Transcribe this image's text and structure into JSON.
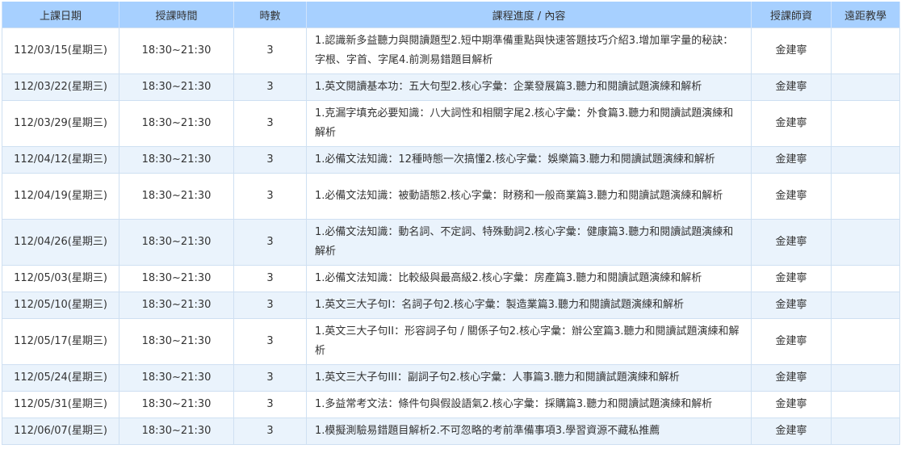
{
  "headers": {
    "date": "上課日期",
    "time": "授課時間",
    "hours": "時數",
    "content": "課程進度 / 內容",
    "teacher": "授課師資",
    "remote": "遠距教學"
  },
  "rows": [
    {
      "date": "112/03/15(星期三)",
      "time": "18:30~21:30",
      "hours": "3",
      "content": "1.認識新多益聽力與閱讀題型2.短中期準備重點與快速答題技巧介紹3.增加單字量的秘訣：字根、字首、字尾4.前測易錯題目解析",
      "teacher": "金建寧",
      "remote": ""
    },
    {
      "date": "112/03/22(星期三)",
      "time": "18:30~21:30",
      "hours": "3",
      "content": "1.英文閱讀基本功：五大句型2.核心字彙：企業發展篇3.聽力和閱讀試題演練和解析",
      "teacher": "金建寧",
      "remote": ""
    },
    {
      "date": "112/03/29(星期三)",
      "time": "18:30~21:30",
      "hours": "3",
      "content": "1.克漏字填充必要知識：八大詞性和相關字尾2.核心字彙：外食篇3.聽力和閱讀試題演練和解析",
      "teacher": "金建寧",
      "remote": ""
    },
    {
      "date": "112/04/12(星期三)",
      "time": "18:30~21:30",
      "hours": "3",
      "content": "1.必備文法知識：12種時態一次搞懂2.核心字彙：娛樂篇3.聽力和閱讀試題演練和解析",
      "teacher": "金建寧",
      "remote": ""
    },
    {
      "date": "112/04/19(星期三)",
      "time": "18:30~21:30",
      "hours": "3",
      "content": "1.必備文法知識：被動語態2.核心字彙：財務和一般商業篇3.聽力和閱讀試題演練和解析",
      "teacher": "金建寧",
      "remote": ""
    },
    {
      "date": "112/04/26(星期三)",
      "time": "18:30~21:30",
      "hours": "3",
      "content": "1.必備文法知識：動名詞、不定詞、特殊動詞2.核心字彙：健康篇3.聽力和閱讀試題演練和解析",
      "teacher": "金建寧",
      "remote": ""
    },
    {
      "date": "112/05/03(星期三)",
      "time": "18:30~21:30",
      "hours": "3",
      "content": "1.必備文法知識：比較級與最高級2.核心字彙：房產篇3.聽力和閱讀試題演練和解析",
      "teacher": "金建寧",
      "remote": ""
    },
    {
      "date": "112/05/10(星期三)",
      "time": "18:30~21:30",
      "hours": "3",
      "content": "1.英文三大子句I：名詞子句2.核心字彙：製造業篇3.聽力和閱讀試題演練和解析",
      "teacher": "金建寧",
      "remote": ""
    },
    {
      "date": "112/05/17(星期三)",
      "time": "18:30~21:30",
      "hours": "3",
      "content": "1.英文三大子句II：形容詞子句 / 關係子句2.核心字彙：辦公室篇3.聽力和閱讀試題演練和解析",
      "teacher": "金建寧",
      "remote": ""
    },
    {
      "date": "112/05/24(星期三)",
      "time": "18:30~21:30",
      "hours": "3",
      "content": "1.英文三大子句III：副詞子句2.核心字彙：人事篇3.聽力和閱讀試題演練和解析",
      "teacher": "金建寧",
      "remote": ""
    },
    {
      "date": "112/05/31(星期三)",
      "time": "18:30~21:30",
      "hours": "3",
      "content": "1.多益常考文法：條件句與假設語氣2.核心字彙：採購篇3.聽力和閱讀試題演練和解析",
      "teacher": "金建寧",
      "remote": ""
    },
    {
      "date": "112/06/07(星期三)",
      "time": "18:30~21:30",
      "hours": "3",
      "content": "1.模擬測驗易錯題目解析2.不可忽略的考前準備事項3.學習資源不藏私推薦",
      "teacher": "金建寧",
      "remote": ""
    }
  ],
  "colors": {
    "header_bg": "#a7d0ff",
    "row_alt_bg": "#eaf3fc",
    "border": "#cfe0f2"
  }
}
